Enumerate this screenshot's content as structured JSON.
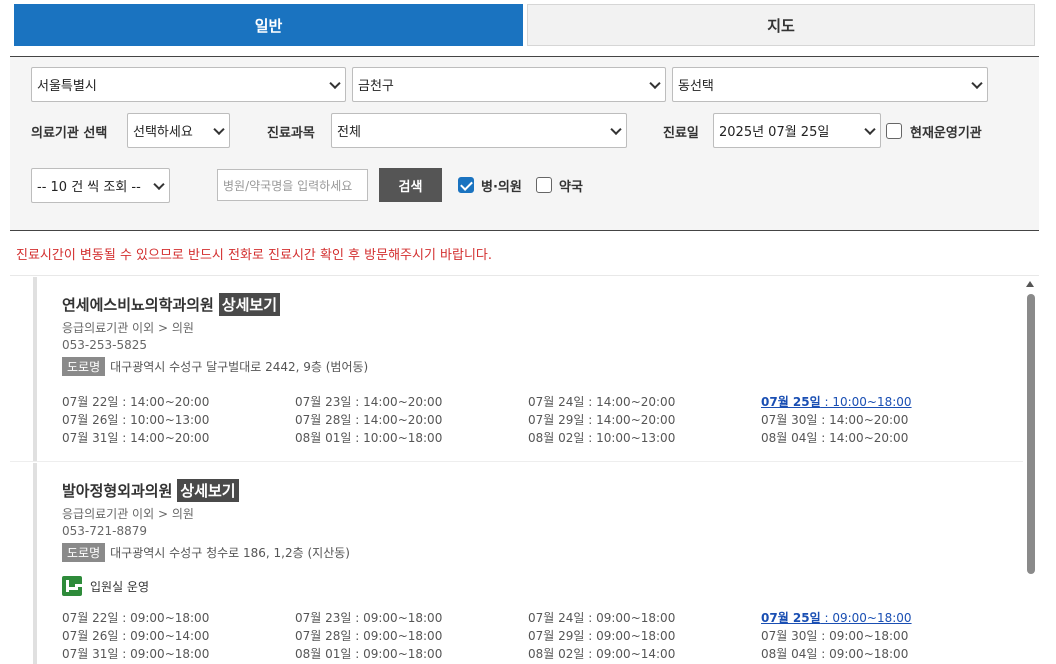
{
  "tabs": {
    "general": "일반",
    "map": "지도"
  },
  "filters": {
    "city": "서울특별시",
    "district": "금천구",
    "dong": "동선택",
    "institution_label": "의료기관 선택",
    "institution_value": "선택하세요",
    "dept_label": "진료과목",
    "dept_value": "전체",
    "date_label": "진료일",
    "date_value": "2025년 07월 25일",
    "operating_label": "현재운영기관",
    "page_size": "-- 10 건 씩 조회 --",
    "search_placeholder": "병원/약국명을 입력하세요",
    "search_button": "검색",
    "hospital_label": "병·의원",
    "pharmacy_label": "약국"
  },
  "notice": "진료시간이 변동될 수 있으므로 반드시 전화로 진료시간 확인 후 방문해주시기 바랍니다.",
  "detail_label": "상세보기",
  "road_tag": "도로명",
  "results": [
    {
      "name": "연세에스비뇨의학과의원",
      "category": "응급의료기관 이외 > 의원",
      "phone": "053-253-5825",
      "address": "대구광역시 수성구 달구벌대로 2442, 9층 (범어동)",
      "schedule": [
        [
          {
            "d": "07월 22일",
            "t": " : 14:00~20:00"
          },
          {
            "d": "07월 23일",
            "t": " : 14:00~20:00"
          },
          {
            "d": "07월 24일",
            "t": " : 14:00~20:00"
          },
          {
            "d": "07월 25일",
            "t": " : 10:00~18:00"
          }
        ],
        [
          {
            "d": "07월 26일",
            "t": " : 10:00~13:00"
          },
          {
            "d": "07월 28일",
            "t": " : 14:00~20:00"
          },
          {
            "d": "07월 29일",
            "t": " : 14:00~20:00"
          },
          {
            "d": "07월 30일",
            "t": " : 14:00~20:00"
          }
        ],
        [
          {
            "d": "07월 31일",
            "t": " : 14:00~20:00"
          },
          {
            "d": "08월 01일",
            "t": " : 10:00~18:00"
          },
          {
            "d": "08월 02일",
            "t": " : 10:00~13:00"
          },
          {
            "d": "08월 04일",
            "t": " : 14:00~20:00"
          }
        ]
      ]
    },
    {
      "name": "발아정형외과의원",
      "category": "응급의료기관 이외 > 의원",
      "phone": "053-721-8879",
      "address": "대구광역시 수성구 청수로 186, 1,2층 (지산동)",
      "ward": "입원실 운영",
      "schedule": [
        [
          {
            "d": "07월 22일",
            "t": " : 09:00~18:00"
          },
          {
            "d": "07월 23일",
            "t": " : 09:00~18:00"
          },
          {
            "d": "07월 24일",
            "t": " : 09:00~18:00"
          },
          {
            "d": "07월 25일",
            "t": " : 09:00~18:00"
          }
        ],
        [
          {
            "d": "07월 26일",
            "t": " : 09:00~14:00"
          },
          {
            "d": "07월 28일",
            "t": " : 09:00~18:00"
          },
          {
            "d": "07월 29일",
            "t": " : 09:00~18:00"
          },
          {
            "d": "07월 30일",
            "t": " : 09:00~18:00"
          }
        ],
        [
          {
            "d": "07월 31일",
            "t": " : 09:00~18:00"
          },
          {
            "d": "08월 01일",
            "t": " : 09:00~18:00"
          },
          {
            "d": "08월 02일",
            "t": " : 09:00~14:00"
          },
          {
            "d": "08월 04일",
            "t": " : 09:00~18:00"
          }
        ]
      ]
    }
  ]
}
